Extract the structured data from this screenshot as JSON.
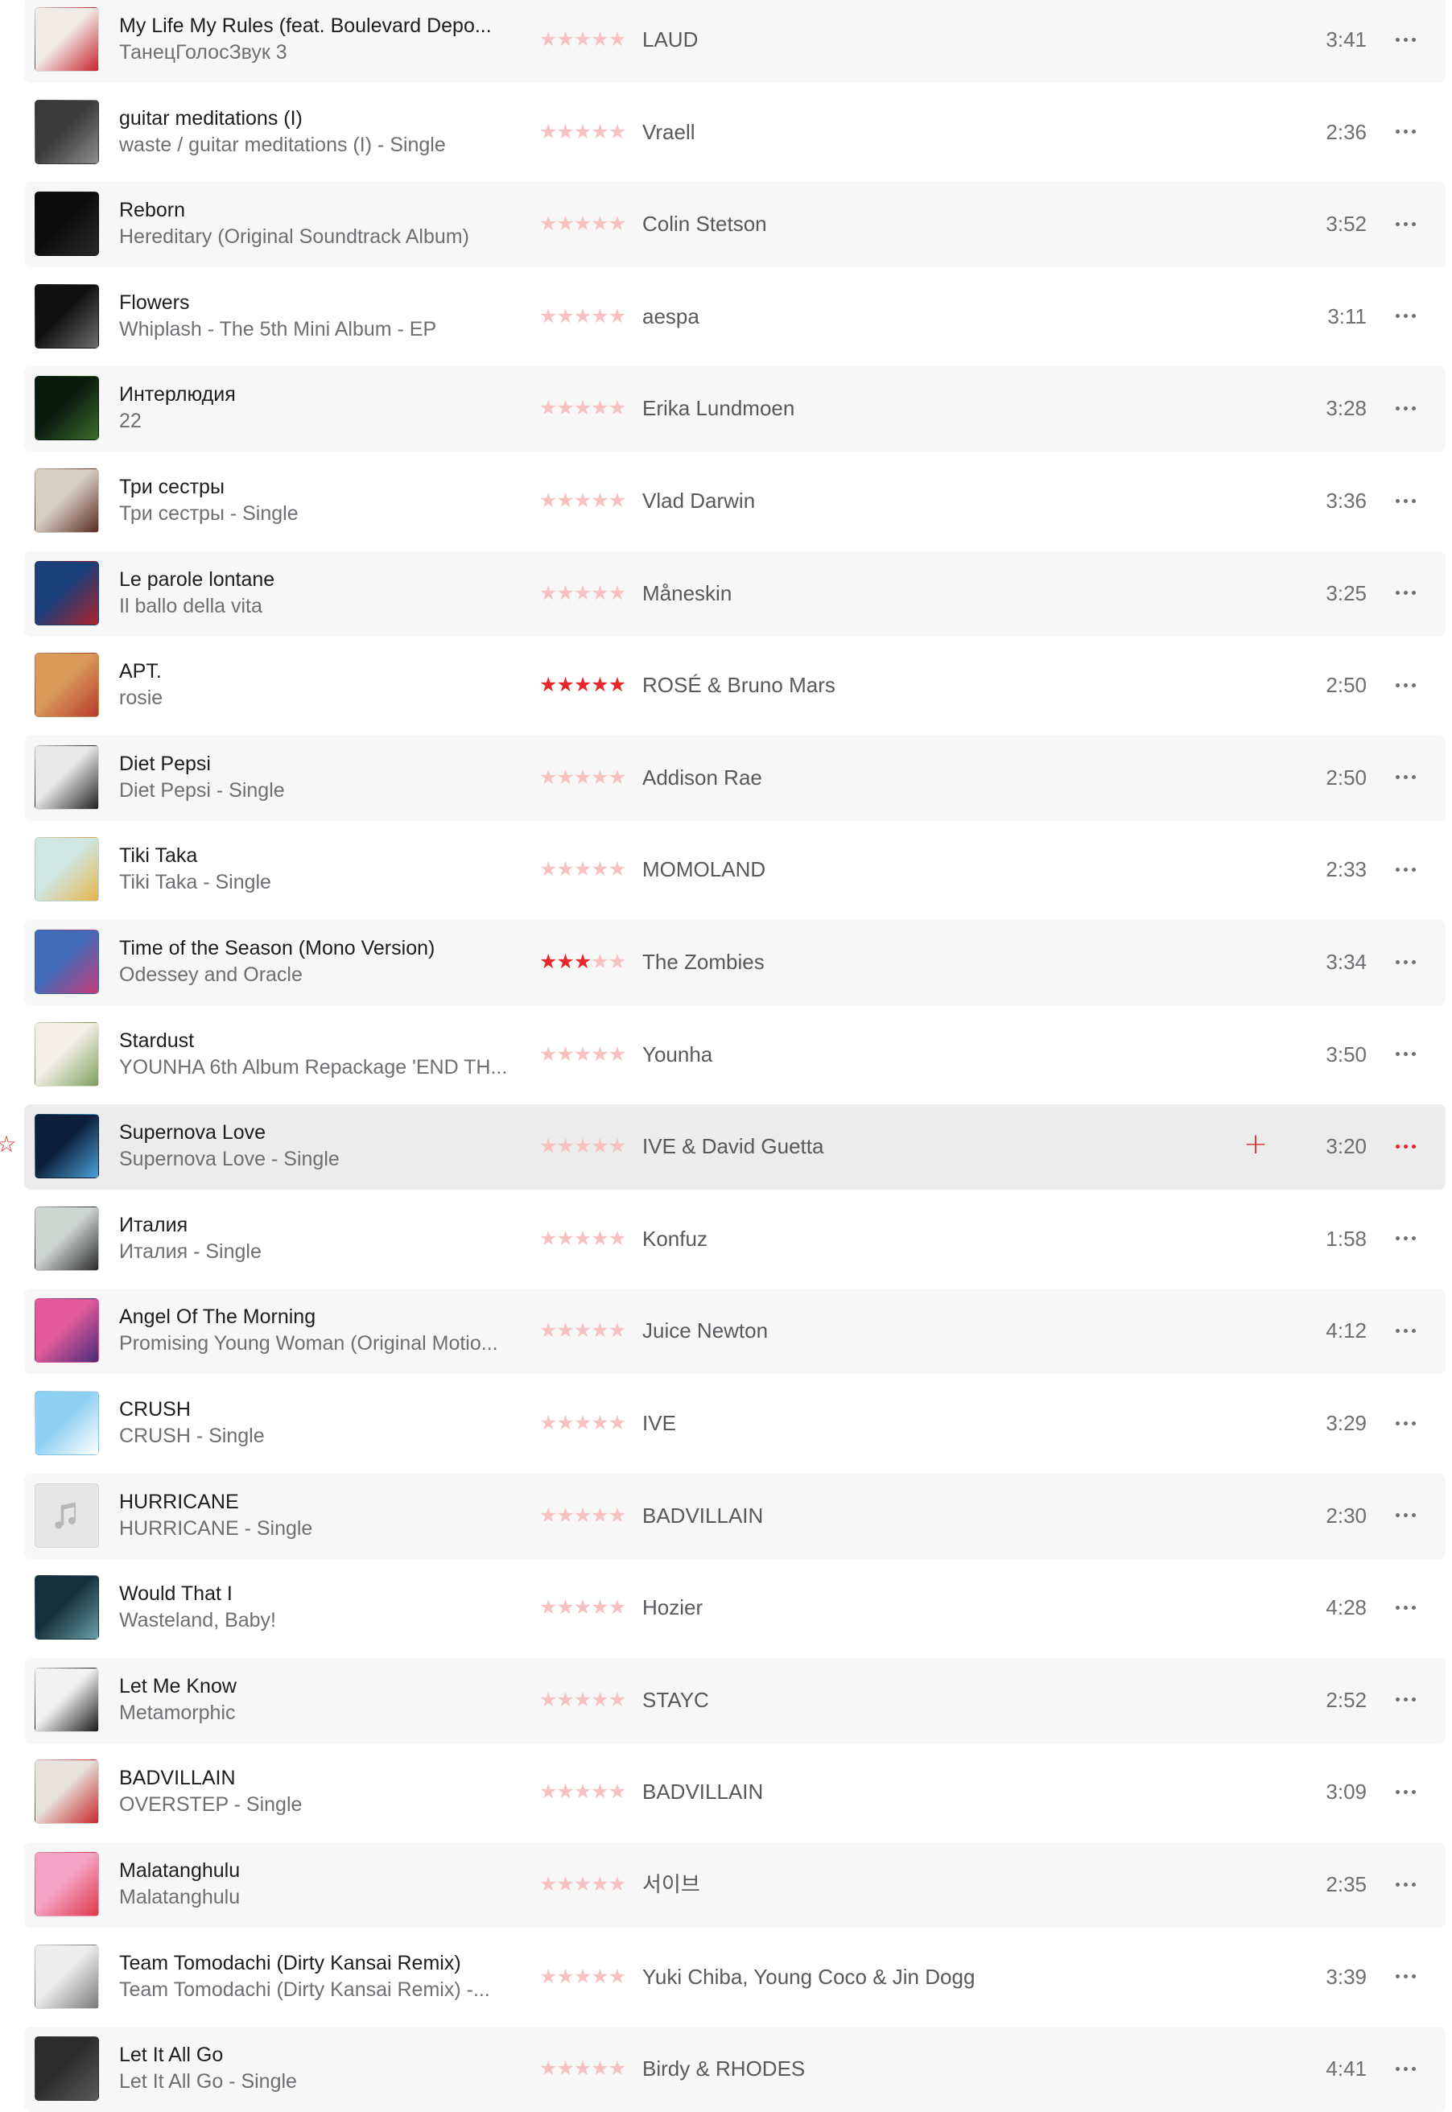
{
  "colors": {
    "accent": "#e5262a",
    "star_dim": "#f7c1c2",
    "row_alt": "#f7f7f7",
    "row_selected": "#ececec"
  },
  "tracks": [
    {
      "title": "My Life My Rules (feat. Boulevard Depo...",
      "album": "ТанецГолосЗвук 3",
      "artist": "LAUD",
      "duration": "3:41",
      "rating": 0,
      "art": [
        "#f1ece8",
        "#c7232d"
      ],
      "art_icon": "album-art-icon"
    },
    {
      "title": "guitar meditations (I)",
      "album": "waste / guitar meditations (I) - Single",
      "artist": "Vraell",
      "duration": "2:36",
      "rating": 0,
      "art": [
        "#3a3a3a",
        "#8c8c8c"
      ],
      "art_icon": "album-art-icon"
    },
    {
      "title": "Reborn",
      "album": "Hereditary (Original Soundtrack Album)",
      "artist": "Colin Stetson",
      "duration": "3:52",
      "rating": 0,
      "art": [
        "#0c0c0c",
        "#2a2a2a"
      ],
      "art_icon": "album-art-icon"
    },
    {
      "title": "Flowers",
      "album": "Whiplash - The 5th Mini Album - EP",
      "artist": "aespa",
      "duration": "3:11",
      "rating": 0,
      "art": [
        "#111111",
        "#6d6d6d"
      ],
      "art_icon": "album-art-icon"
    },
    {
      "title": "Интерлюдия",
      "album": "22",
      "artist": "Erika Lundmoen",
      "duration": "3:28",
      "rating": 0,
      "art": [
        "#0b1a0e",
        "#3b6f2b"
      ],
      "art_icon": "album-art-icon"
    },
    {
      "title": "Три сестры",
      "album": "Три сестры - Single",
      "artist": "Vlad Darwin",
      "duration": "3:36",
      "rating": 0,
      "art": [
        "#d8cfc4",
        "#5a2a22"
      ],
      "art_icon": "album-art-icon"
    },
    {
      "title": "Le parole lontane",
      "album": "Il ballo della vita",
      "artist": "Måneskin",
      "duration": "3:25",
      "rating": 0,
      "art": [
        "#1a3f7a",
        "#b2222a"
      ],
      "art_icon": "album-art-icon"
    },
    {
      "title": "APT.",
      "album": "rosie",
      "artist": "ROSÉ & Bruno Mars",
      "duration": "2:50",
      "rating": 5,
      "art": [
        "#d99a5a",
        "#b63b2d"
      ],
      "art_icon": "album-art-icon"
    },
    {
      "title": "Diet Pepsi",
      "album": "Diet Pepsi - Single",
      "artist": "Addison Rae",
      "duration": "2:50",
      "rating": 0,
      "art": [
        "#e9e9e9",
        "#1f1f1f"
      ],
      "art_icon": "album-art-icon"
    },
    {
      "title": "Tiki Taka",
      "album": "Tiki Taka - Single",
      "artist": "MOMOLAND",
      "duration": "2:33",
      "rating": 0,
      "art": [
        "#cfe6e3",
        "#e6b64a"
      ],
      "art_icon": "album-art-icon"
    },
    {
      "title": "Time of the Season (Mono Version)",
      "album": "Odessey and Oracle",
      "artist": "The Zombies",
      "duration": "3:34",
      "rating": 3,
      "art": [
        "#3f6bb8",
        "#c83a78"
      ],
      "art_icon": "album-art-icon"
    },
    {
      "title": "Stardust",
      "album": "YOUNHA 6th Album Repackage 'END TH...",
      "artist": "Younha",
      "duration": "3:50",
      "rating": 0,
      "art": [
        "#f3eee6",
        "#7aa05a"
      ],
      "art_icon": "album-art-icon"
    },
    {
      "title": "Supernova Love",
      "album": "Supernova Love - Single",
      "artist": "IVE & David Guetta",
      "duration": "3:20",
      "rating": 0,
      "art": [
        "#0d1f3a",
        "#4aa3d8"
      ],
      "art_icon": "album-art-icon"
    },
    {
      "title": "Италия",
      "album": "Италия - Single",
      "artist": "Konfuz",
      "duration": "1:58",
      "rating": 0,
      "art": [
        "#cfd6d2",
        "#2a2a2a"
      ],
      "art_icon": "album-art-icon"
    },
    {
      "title": "Angel Of The Morning",
      "album": "Promising Young Woman (Original Motio...",
      "artist": "Juice Newton",
      "duration": "4:12",
      "rating": 0,
      "art": [
        "#e25a9a",
        "#4a2a7a"
      ],
      "art_icon": "album-art-icon"
    },
    {
      "title": "CRUSH",
      "album": "CRUSH - Single",
      "artist": "IVE",
      "duration": "3:29",
      "rating": 0,
      "art": [
        "#8fd0f2",
        "#ffffff"
      ],
      "art_icon": "album-art-icon"
    },
    {
      "title": "HURRICANE",
      "album": "HURRICANE - Single",
      "artist": "BADVILLAIN",
      "duration": "2:30",
      "rating": 0,
      "art": [
        "#e9e9e9",
        "#bdbdbd"
      ],
      "art_icon": "music-note-icon"
    },
    {
      "title": "Would That I",
      "album": "Wasteland, Baby!",
      "artist": "Hozier",
      "duration": "4:28",
      "rating": 0,
      "art": [
        "#14303a",
        "#6aa0a8"
      ],
      "art_icon": "album-art-icon"
    },
    {
      "title": "Let Me Know",
      "album": "Metamorphic",
      "artist": "STAYC",
      "duration": "2:52",
      "rating": 0,
      "art": [
        "#f2f2f2",
        "#1a1a1a"
      ],
      "art_icon": "album-art-icon"
    },
    {
      "title": "BADVILLAIN",
      "album": "OVERSTEP - Single",
      "artist": "BADVILLAIN",
      "duration": "3:09",
      "rating": 0,
      "art": [
        "#e7e2dc",
        "#c8262b"
      ],
      "art_icon": "album-art-icon"
    },
    {
      "title": "Malatanghulu",
      "album": "Malatanghulu",
      "artist": "서이브",
      "duration": "2:35",
      "rating": 0,
      "art": [
        "#f3a3c4",
        "#e2394a"
      ],
      "art_icon": "album-art-icon"
    },
    {
      "title": "Team Tomodachi (Dirty Kansai Remix)",
      "album": "Team Tomodachi (Dirty Kansai Remix) -...",
      "artist": "Yuki Chiba, Young Coco & Jin Dogg",
      "duration": "3:39",
      "rating": 0,
      "art": [
        "#ededed",
        "#7a7a7a"
      ],
      "art_icon": "album-art-icon"
    },
    {
      "title": "Let It All Go",
      "album": "Let It All Go - Single",
      "artist": "Birdy & RHODES",
      "duration": "4:41",
      "rating": 0,
      "art": [
        "#2c2c2c",
        "#5a5a5a"
      ],
      "art_icon": "album-art-icon"
    }
  ],
  "selected_index": 12,
  "selected_row": {
    "favorite_icon": "☆",
    "add_icon": "+"
  }
}
